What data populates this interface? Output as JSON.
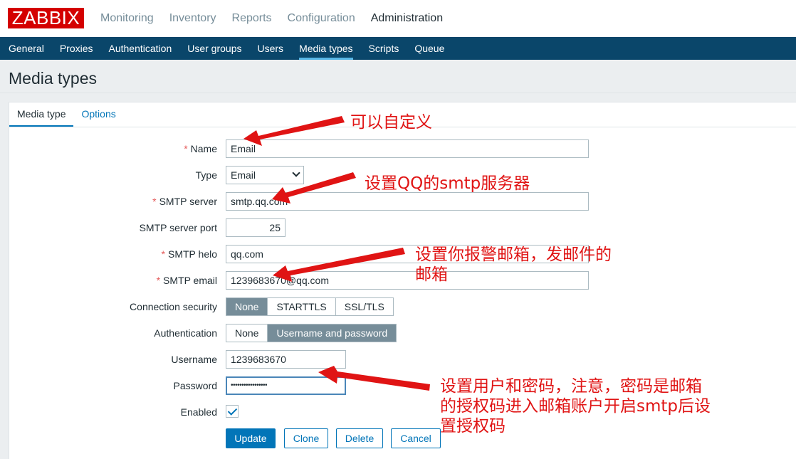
{
  "brand": {
    "logo": "ZABBIX",
    "color": "#d40000"
  },
  "main_nav": [
    {
      "label": "Monitoring",
      "active": false
    },
    {
      "label": "Inventory",
      "active": false
    },
    {
      "label": "Reports",
      "active": false
    },
    {
      "label": "Configuration",
      "active": false
    },
    {
      "label": "Administration",
      "active": true
    }
  ],
  "sub_nav": [
    {
      "label": "General",
      "active": false
    },
    {
      "label": "Proxies",
      "active": false
    },
    {
      "label": "Authentication",
      "active": false
    },
    {
      "label": "User groups",
      "active": false
    },
    {
      "label": "Users",
      "active": false
    },
    {
      "label": "Media types",
      "active": true
    },
    {
      "label": "Scripts",
      "active": false
    },
    {
      "label": "Queue",
      "active": false
    }
  ],
  "page": {
    "title": "Media types"
  },
  "tabs": [
    {
      "label": "Media type",
      "active": true
    },
    {
      "label": "Options",
      "active": false
    }
  ],
  "form": {
    "name": {
      "label": "Name",
      "value": "Email"
    },
    "type": {
      "label": "Type",
      "value": "Email"
    },
    "smtp_server": {
      "label": "SMTP server",
      "value": "smtp.qq.com"
    },
    "smtp_port": {
      "label": "SMTP server port",
      "value": "25"
    },
    "smtp_helo": {
      "label": "SMTP helo",
      "value": "qq.com"
    },
    "smtp_email": {
      "label": "SMTP email",
      "value": "1239683670@qq.com"
    },
    "conn_security": {
      "label": "Connection security",
      "options": [
        "None",
        "STARTTLS",
        "SSL/TLS"
      ],
      "selected": "None"
    },
    "authentication": {
      "label": "Authentication",
      "options": [
        "None",
        "Username and password"
      ],
      "selected": "Username and password"
    },
    "username": {
      "label": "Username",
      "value": "1239683670"
    },
    "password": {
      "label": "Password",
      "value": "•••••••••••••••••"
    },
    "enabled": {
      "label": "Enabled",
      "checked": true
    }
  },
  "buttons": {
    "update": "Update",
    "clone": "Clone",
    "delete": "Delete",
    "cancel": "Cancel"
  },
  "annotations": {
    "name_note": "可以自定义",
    "smtp_note": "设置QQ的smtp服务器",
    "email_note_1": "设置你报警邮箱，发邮件的",
    "email_note_2": "邮箱",
    "pwd_note_1": "设置用户和密码，注意，密码是邮箱",
    "pwd_note_2": "的授权码进入邮箱账户开启smtp后设",
    "pwd_note_3": "置授权码"
  },
  "colors": {
    "nav_bg": "#0a466a",
    "accent": "#0275b8",
    "annotation": "#e01414",
    "required": "#e45959"
  }
}
